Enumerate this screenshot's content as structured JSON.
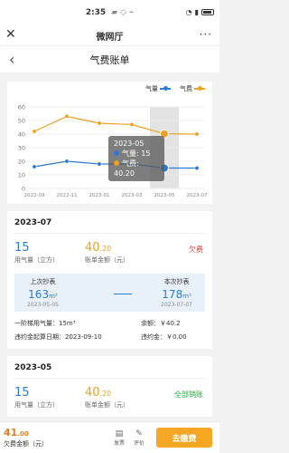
{
  "status_bar": {
    "time": "2:35",
    "icons_text": "▰ ◇ ⌁"
  },
  "top_bar": {
    "title": "微网厅",
    "more": "···"
  },
  "nav": {
    "title": "气费账单"
  },
  "legend": [
    {
      "label": "气量",
      "color": "#2b7bd6"
    },
    {
      "label": "气费",
      "color": "#f0a020"
    }
  ],
  "tooltip": {
    "date": "2023-05",
    "gas_label": "气量: 15",
    "fee_label": "气费: 40.20"
  },
  "chart_data": {
    "type": "line",
    "x": [
      "2022-09",
      "2022-11",
      "2023-01",
      "2023-03",
      "2023-05",
      "2023-07"
    ],
    "ylim": [
      0,
      60
    ],
    "yticks": [
      0,
      10,
      20,
      30,
      40,
      50,
      60
    ],
    "series": [
      {
        "name": "气量",
        "color": "#2b7bd6",
        "values": [
          16,
          20,
          18,
          18,
          15,
          15
        ]
      },
      {
        "name": "气费",
        "color": "#f0a020",
        "values": [
          42,
          53,
          48,
          47,
          40.2,
          40
        ]
      }
    ],
    "highlight_index": 4
  },
  "records": [
    {
      "month": "2023-07",
      "usage": "15",
      "usage_label": "用气量（立方）",
      "fee": "40",
      "fee_decimal": ".20",
      "fee_label": "账单金额（元）",
      "status": "欠费",
      "last_reading_label": "上次抄表",
      "last_reading": "163",
      "last_reading_unit": "m³",
      "last_reading_date": "2023-05-05",
      "this_reading_label": "本次抄表",
      "this_reading": "178",
      "this_reading_unit": "m³",
      "this_reading_date": "2023-07-07",
      "detail1": "一阶梯用气量：15m³",
      "detail2": "余额：￥40.2",
      "detail3": "违约金起算日期：2023-09-10",
      "detail4": "违约金：￥0.00"
    },
    {
      "month": "2023-05",
      "usage": "15",
      "usage_label": "用气量（立方）",
      "fee": "40",
      "fee_decimal": ".20",
      "fee_label": "账单金额（元）",
      "status": "全部销账"
    }
  ],
  "bottom": {
    "amount": "41",
    "amount_decimal": ".00",
    "amount_label": "欠费金额（元）",
    "icon1_label": "发票",
    "icon2_label": "评价",
    "pay_label": "去缴费"
  }
}
